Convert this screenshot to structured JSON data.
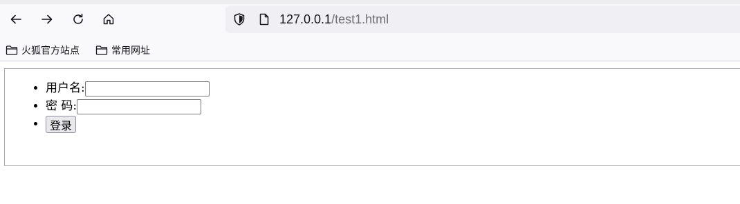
{
  "browser": {
    "url_host": "127.0.0.1",
    "url_path": "/test1.html",
    "nav_icons": [
      "back-arrow-icon",
      "forward-arrow-icon",
      "reload-icon",
      "home-icon"
    ]
  },
  "bookmarks": [
    {
      "label": "火狐官方站点",
      "icon": "folder-icon"
    },
    {
      "label": "常用网址",
      "icon": "folder-icon"
    }
  ],
  "login_form": {
    "username_label": "用户名:",
    "username_value": "",
    "password_label": "密 码:",
    "password_value": "",
    "submit_label": "登录"
  }
}
